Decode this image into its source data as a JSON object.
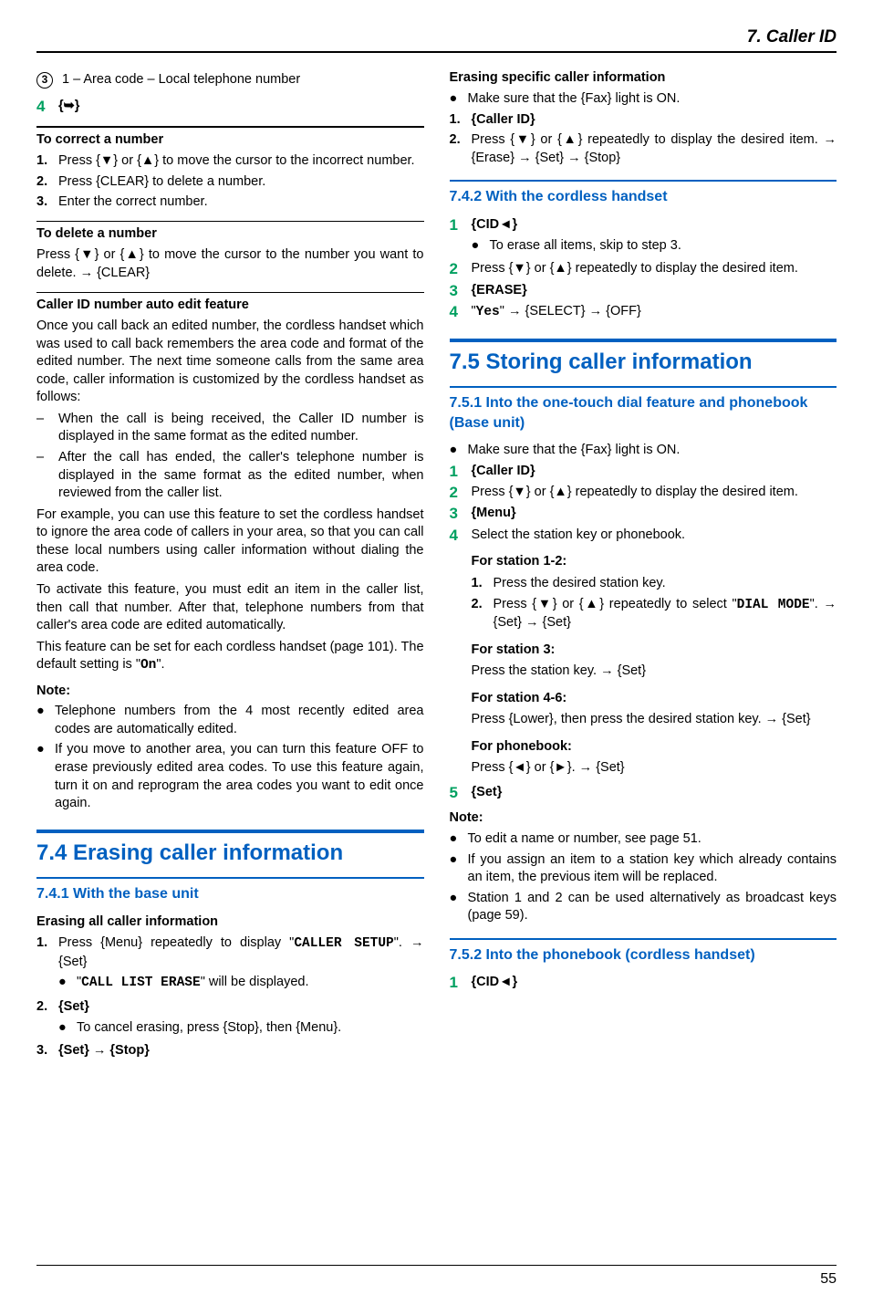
{
  "header": "7. Caller ID",
  "page_number": "55",
  "left": {
    "c3": {
      "num": "3",
      "text": "1 – Area code – Local telephone number"
    },
    "bigstep4": {
      "num": "4",
      "text": "{➥}"
    },
    "correct_head": "To correct a number",
    "correct_steps": [
      {
        "n": "1.",
        "t": "Press {▼} or {▲} to move the cursor to the incorrect number."
      },
      {
        "n": "2.",
        "t": "Press {CLEAR} to delete a number."
      },
      {
        "n": "3.",
        "t": "Enter the correct number."
      }
    ],
    "delete_head": "To delete a number",
    "delete_para": "Press {▼} or {▲} to move the cursor to the number you want to delete. → {CLEAR}",
    "autoedit_head": "Caller ID number auto edit feature",
    "autoedit_p1": "Once you call back an edited number, the cordless handset which was used to call back remembers the area code and format of the edited number. The next time someone calls from the same area code, caller information is customized by the cordless handset as follows:",
    "autoedit_dashes": [
      "When the call is being received, the Caller ID number is displayed in the same format as the edited number.",
      "After the call has ended, the caller's telephone number is displayed in the same format as the edited number, when reviewed from the caller list."
    ],
    "autoedit_p2": "For example, you can use this feature to set the cordless handset to ignore the area code of callers in your area, so that you can call these local numbers using caller information without dialing the area code.",
    "autoedit_p3": "To activate this feature, you must edit an item in the caller list, then call that number. After that, telephone numbers from that caller's area code are edited automatically.",
    "autoedit_p4a": "This feature can be set for each cordless handset (page 101). The default setting is \"",
    "autoedit_p4_mono": "On",
    "autoedit_p4b": "\".",
    "note": "Note:",
    "note_bullets": [
      "Telephone numbers from the 4 most recently edited area codes are automatically edited.",
      "If you move to another area, you can turn this feature OFF to erase previously edited area codes. To use this feature again, turn it on and reprogram the area codes you want to edit once again."
    ],
    "h74": "7.4 Erasing caller information",
    "h741": "7.4.1 With the base unit",
    "erase_all_head": "Erasing all caller information",
    "erase_all_steps": {
      "s1a": "Press {Menu} repeatedly to display \"",
      "s1_mono": "CALLER SETUP",
      "s1b": "\". → {Set}",
      "s1_bullet_a": "\"",
      "s1_bullet_mono": "CALL LIST ERASE",
      "s1_bullet_b": "\" will be displayed.",
      "s2": "{Set}",
      "s2_bullet": "To cancel erasing, press {Stop}, then {Menu}.",
      "s3": "{Set} → {Stop}"
    }
  },
  "right": {
    "erase_spec_head": "Erasing specific caller information",
    "erase_spec_bullet": "Make sure that the {Fax} light is ON.",
    "erase_spec_steps": [
      {
        "n": "1.",
        "t": "{Caller ID}"
      },
      {
        "n": "2.",
        "t": "Press {▼} or {▲} repeatedly to display the desired item. → {Erase} → {Set} → {Stop}"
      }
    ],
    "h742": "7.4.2 With the cordless handset",
    "cordless_steps": {
      "s1": "{CID◄}",
      "s1_bullet": "To erase all items, skip to step 3.",
      "s2": "Press {▼} or {▲} repeatedly to display the desired item.",
      "s3": "{ERASE}",
      "s4a": "\"",
      "s4_mono": "Yes",
      "s4b": "\" → {SELECT} → {OFF}"
    },
    "h75": "7.5 Storing caller information",
    "h751": "7.5.1 Into the one-touch dial feature and phonebook (Base unit)",
    "store_bullet": "Make sure that the {Fax} light is ON.",
    "store_steps": {
      "s1": "{Caller ID}",
      "s2": "Press {▼} or {▲} repeatedly to display the desired item.",
      "s3": "{Menu}",
      "s4_lead": "Select the station key or phonebook.",
      "st12_head": "For station 1-2:",
      "st12_1": "Press the desired station key.",
      "st12_2a": "Press {▼} or {▲} repeatedly to select \"",
      "st12_2_mono": "DIAL MODE",
      "st12_2b": "\". → {Set} → {Set}",
      "st3_head": "For station 3:",
      "st3_p": "Press the station key. → {Set}",
      "st46_head": "For station 4-6:",
      "st46_p": "Press {Lower}, then press the desired station key. → {Set}",
      "pb_head": "For phonebook:",
      "pb_p": "Press {◄} or {►}. → {Set}",
      "s5": "{Set}"
    },
    "store_note": "Note:",
    "store_note_bullets": [
      "To edit a name or number, see page 51.",
      "If you assign an item to a station key which already contains an item, the previous item will be replaced.",
      "Station 1 and 2 can be used alternatively as broadcast keys (page 59)."
    ],
    "h752": "7.5.2 Into the phonebook (cordless handset)",
    "pb_cordless_s1": "{CID◄}"
  }
}
